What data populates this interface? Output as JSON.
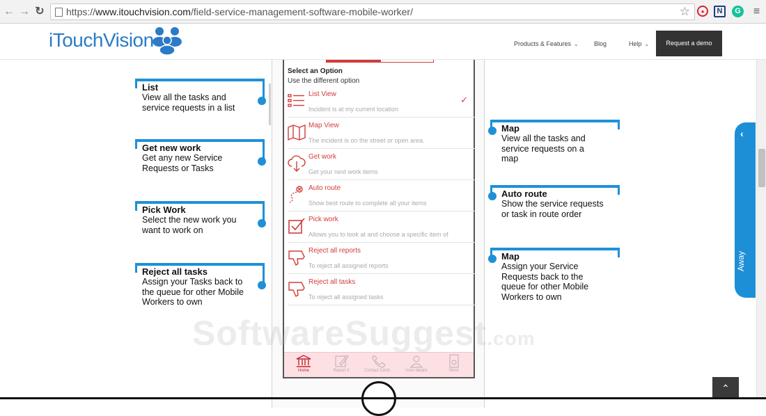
{
  "browser": {
    "url_scheme": "https://",
    "url_host": "www.itouchvision.com",
    "url_path": "/field-service-management-software-mobile-worker/",
    "extensions": [
      "target-icon",
      "notion-icon",
      "grammarly-icon",
      "menu-icon"
    ]
  },
  "header": {
    "logo": "iTouchVision",
    "menu": [
      {
        "label": "Products & Features",
        "caret": true
      },
      {
        "label": "Blog",
        "caret": false
      },
      {
        "label": "Help",
        "caret": true
      }
    ],
    "cta": "Request a demo"
  },
  "phone": {
    "section_title": "Select an Option",
    "section_subtitle": "Use the different option",
    "options": [
      {
        "title": "List View",
        "subtitle": "Incident is at my current location",
        "icon": "list-icon",
        "selected": true
      },
      {
        "title": "Map View",
        "subtitle": "The incident is on the street or open area.",
        "icon": "map-icon",
        "selected": false
      },
      {
        "title": "Get work",
        "subtitle": "Get your next work items",
        "icon": "cloud-download-icon",
        "selected": false
      },
      {
        "title": "Auto route",
        "subtitle": "Show best route to complete all your items",
        "icon": "route-icon",
        "selected": false
      },
      {
        "title": "Pick work",
        "subtitle": "Allows you to look at and choose a specific item of",
        "icon": "checkbox-icon",
        "selected": false
      },
      {
        "title": "Reject all reports",
        "subtitle": "To reject all assigned reports",
        "icon": "thumbs-down-icon",
        "selected": false
      },
      {
        "title": "Reject all tasks",
        "subtitle": "To reject all assigned tasks",
        "icon": "thumbs-down-icon",
        "selected": false
      }
    ],
    "tabbar": [
      {
        "label": "Home",
        "icon": "bank-icon",
        "active": true
      },
      {
        "label": "Report it",
        "icon": "pencil-icon",
        "active": false
      },
      {
        "label": "Contact Centr...",
        "icon": "phone-icon",
        "active": false
      },
      {
        "label": "User details",
        "icon": "user-icon",
        "active": false
      },
      {
        "label": "More",
        "icon": "more-icon",
        "active": false
      }
    ]
  },
  "callouts_left": [
    {
      "title": "List",
      "desc": "View all the tasks and service requests in a list"
    },
    {
      "title": "Get new work",
      "desc": "Get any new Service Requests or Tasks"
    },
    {
      "title": "Pick Work",
      "desc": "Select the new work you want to work on"
    },
    {
      "title": "Reject all tasks",
      "desc": "Assign your Tasks back to the queue for other Mobile Workers to own"
    }
  ],
  "callouts_right": [
    {
      "title": "Map",
      "desc": "View all the tasks and service requests on a map"
    },
    {
      "title": "Auto route",
      "desc": "Show the service requests or task in route order"
    },
    {
      "title": "Map",
      "desc": "Assign your Service Requests back to the queue for other Mobile Workers to own"
    }
  ],
  "side_widget": {
    "label": "Away"
  },
  "watermark": {
    "main": "SoftwareSuggest",
    "suffix": ".com"
  },
  "colors": {
    "accent_red": "#d23b3b",
    "callout_blue": "#1e90d8",
    "logo_blue": "#2b7bc7"
  }
}
